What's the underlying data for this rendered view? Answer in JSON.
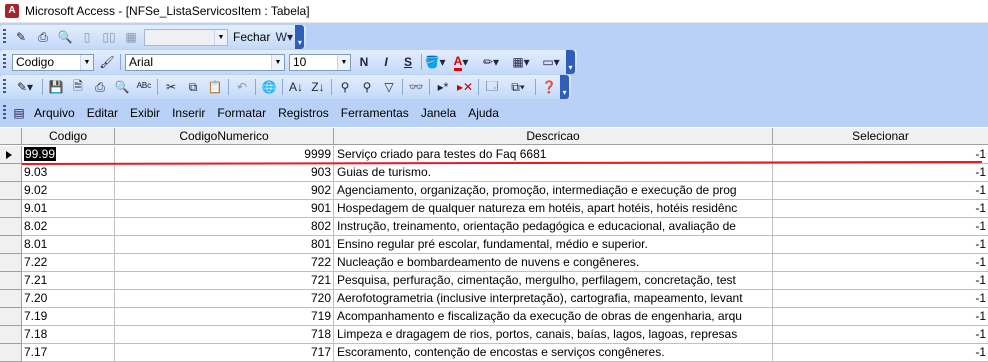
{
  "window": {
    "title": "Microsoft Access - [NFSe_ListaServicosItem : Tabela]",
    "icon": "access-app-icon"
  },
  "toolbar1": {
    "view_combo": "",
    "close_label": "Fechar"
  },
  "toolbar2": {
    "object_combo": "Codigo",
    "font_combo": "Arial",
    "size_combo": "10",
    "bold": "N",
    "italic": "I",
    "underline": "S"
  },
  "menu": [
    "Arquivo",
    "Editar",
    "Exibir",
    "Inserir",
    "Formatar",
    "Registros",
    "Ferramentas",
    "Janela",
    "Ajuda"
  ],
  "table": {
    "columns": [
      "Codigo",
      "CodigoNumerico",
      "Descricao",
      "Selecionar"
    ],
    "rows": [
      {
        "codigo": "99.99",
        "numerico": "9999",
        "descricao": "Serviço criado para testes do Faq 6681",
        "selecionar": "-1"
      },
      {
        "codigo": "9.03",
        "numerico": "903",
        "descricao": "Guias de turismo.",
        "selecionar": "-1"
      },
      {
        "codigo": "9.02",
        "numerico": "902",
        "descricao": "Agenciamento, organização, promoção, intermediação e execução de prog",
        "selecionar": "-1"
      },
      {
        "codigo": "9.01",
        "numerico": "901",
        "descricao": "Hospedagem de qualquer natureza em hotéis, apart hotéis, hotéis residênc",
        "selecionar": "-1"
      },
      {
        "codigo": "8.02",
        "numerico": "802",
        "descricao": "Instrução, treinamento, orientação pedagógica e educacional, avaliação de",
        "selecionar": "-1"
      },
      {
        "codigo": "8.01",
        "numerico": "801",
        "descricao": "Ensino regular pré escolar, fundamental, médio e superior.",
        "selecionar": "-1"
      },
      {
        "codigo": "7.22",
        "numerico": "722",
        "descricao": "Nucleação e bombardeamento de nuvens e congêneres.",
        "selecionar": "-1"
      },
      {
        "codigo": "7.21",
        "numerico": "721",
        "descricao": "Pesquisa, perfuração, cimentação, mergulho, perfilagem, concretação, test",
        "selecionar": "-1"
      },
      {
        "codigo": "7.20",
        "numerico": "720",
        "descricao": "Aerofotogrametria (inclusive interpretação), cartografia, mapeamento, levant",
        "selecionar": "-1"
      },
      {
        "codigo": "7.19",
        "numerico": "719",
        "descricao": "Acompanhamento e fiscalização da execução de obras de engenharia, arqu",
        "selecionar": "-1"
      },
      {
        "codigo": "7.18",
        "numerico": "718",
        "descricao": "Limpeza e dragagem de rios, portos, canais, baías, lagos, lagoas, represas",
        "selecionar": "-1"
      },
      {
        "codigo": "7.17",
        "numerico": "717",
        "descricao": "Escoramento, contenção de encostas e serviços congêneres.",
        "selecionar": "-1"
      }
    ]
  },
  "colors": {
    "toolbar_bg": "#b9d1f7",
    "annotation_line": "#e31b23"
  }
}
